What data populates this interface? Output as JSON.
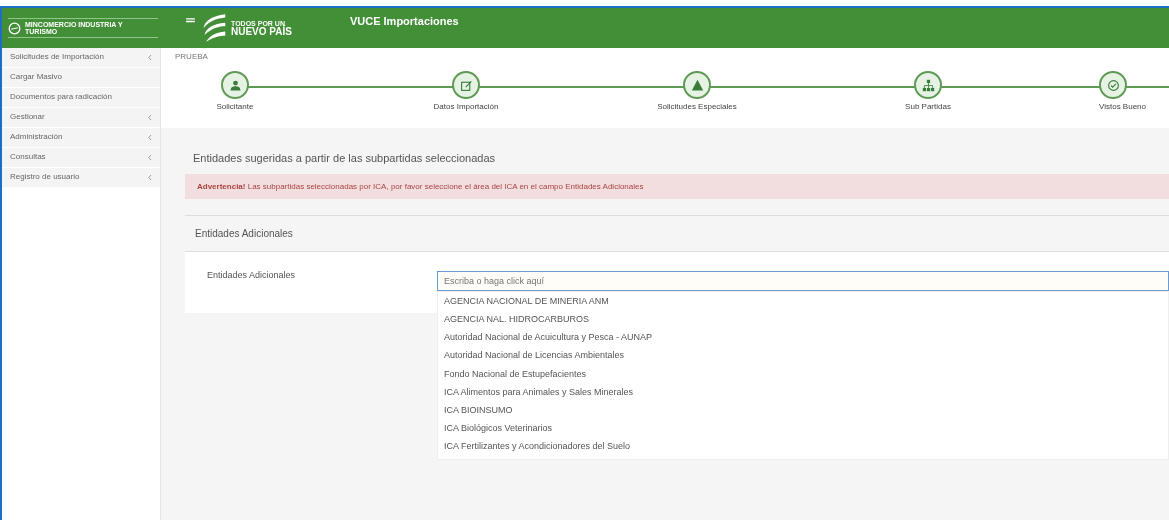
{
  "header": {
    "ministry_logo": "MINCOMERCIO INDUSTRIA Y TURISMO",
    "campaign_logo": [
      "TODOS POR UN",
      "NUEVO PAÍS"
    ],
    "title": "VUCE Importaciones"
  },
  "sidebar": {
    "items": [
      {
        "label": "Solicitudes de Importación",
        "expandable": true
      },
      {
        "label": "Cargar Masivo",
        "expandable": false
      },
      {
        "label": "Documentos para radicación",
        "expandable": false
      },
      {
        "label": "Gestionar",
        "expandable": true
      },
      {
        "label": "Administración",
        "expandable": true
      },
      {
        "label": "Consultas",
        "expandable": true
      },
      {
        "label": "Registro de usuario",
        "expandable": true
      }
    ]
  },
  "breadcrumb": "PRUEBA",
  "steps": [
    {
      "label": "Solicitante"
    },
    {
      "label": "Datos Importación"
    },
    {
      "label": "Solicitudes Especiales"
    },
    {
      "label": "Sub Partidas"
    },
    {
      "label": "Vistos Bueno"
    }
  ],
  "section_title": "Entidades sugeridas a partir de las subpartidas seleccionadas",
  "alert": {
    "strong": "Advertencia!",
    "text": "Las subpartidas seleccionadas por ICA, por favor seleccione el área del ICA en el campo Entidades Adicionales"
  },
  "panel": {
    "title": "Entidades Adicionales",
    "field_label": "Entidades Adicionales",
    "placeholder": "Escriba o haga click aquí",
    "options": [
      "AGENCIA NACIONAL DE MINERIA ANM",
      "AGENCIA NAL. HIDROCARBUROS",
      "Autoridad Nacional de Acuicultura y Pesca - AUNAP",
      "Autoridad Nacional de Licencias Ambientales",
      "Fondo Nacional de Estupefacientes",
      "ICA Alimentos para Animales y Sales Minerales",
      "ICA BIOINSUMO",
      "ICA Biológicos Veterinarios",
      "ICA Fertilizantes y Acondicionadores del Suelo"
    ]
  }
}
